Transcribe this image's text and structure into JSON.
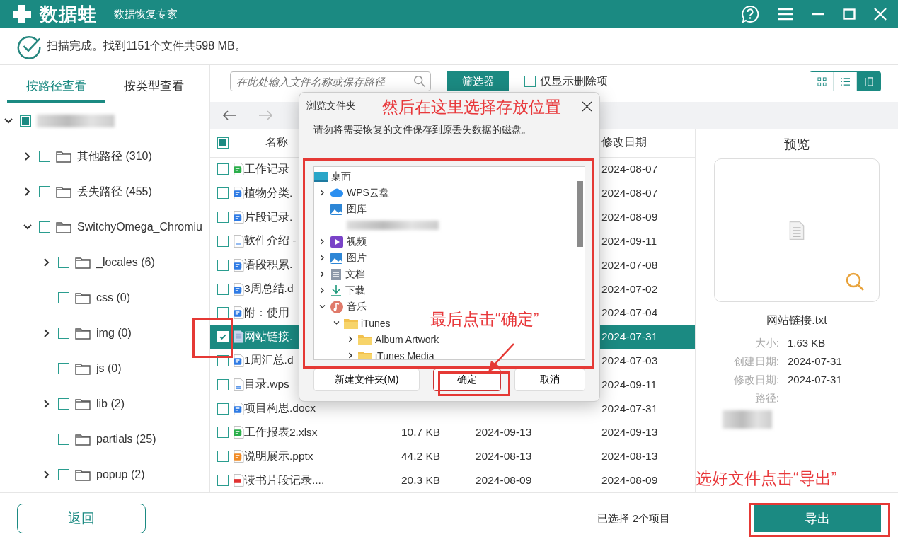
{
  "app": {
    "logo": "数据蛙",
    "subtitle": "数据恢复专家"
  },
  "scan_status": "扫描完成。找到1151个文件共598 MB。",
  "view_tabs": [
    {
      "label": "按路径查看",
      "selected": true
    },
    {
      "label": "按类型查看",
      "selected": false
    }
  ],
  "tree": [
    {
      "redacted": true,
      "checked": false,
      "partial": true,
      "expanded": true,
      "children": [
        {
          "label": "其他路径 (310)",
          "checked": false,
          "expandable": true,
          "expanded": false
        },
        {
          "label": "丢失路径 (455)",
          "checked": false,
          "expandable": true,
          "expanded": false
        },
        {
          "label": "SwitchyOmega_Chromiu",
          "checked": false,
          "expanded": true,
          "children": [
            {
              "label": "_locales (6)",
              "checked": false,
              "expandable": true,
              "expanded": false
            },
            {
              "label": "css (0)",
              "checked": false,
              "expandable": false,
              "expanded": false
            },
            {
              "label": "img (0)",
              "checked": false,
              "expandable": true,
              "expanded": false
            },
            {
              "label": "js (0)",
              "checked": false,
              "expandable": false,
              "expanded": false
            },
            {
              "label": "lib (2)",
              "checked": false,
              "expandable": true,
              "expanded": false
            },
            {
              "label": "partials (25)",
              "checked": false,
              "expandable": false,
              "expanded": false
            },
            {
              "label": "popup (2)",
              "checked": false,
              "expandable": true,
              "expanded": false
            }
          ]
        }
      ]
    }
  ],
  "search": {
    "placeholder": "在此处输入文件名称或保存路径"
  },
  "filter_button": "筛选器",
  "deleted_only": {
    "label": "仅显示删除项",
    "checked": false
  },
  "view_modes": [
    {
      "kind": "grid",
      "selected": false
    },
    {
      "kind": "list",
      "selected": false
    },
    {
      "kind": "preview",
      "selected": true
    }
  ],
  "table": {
    "header_checkbox": {
      "checked": false,
      "partial": true
    },
    "columns": [
      "名称",
      "修改日期"
    ],
    "rows": [
      {
        "kind": "sheet",
        "name": "工作记录",
        "modified": "2024-08-07",
        "checked": false,
        "selected": false
      },
      {
        "kind": "word",
        "name": "植物分类.",
        "modified": "2024-08-07",
        "checked": false,
        "selected": false
      },
      {
        "kind": "word",
        "name": "片段记录.",
        "modified": "2024-08-09",
        "checked": false,
        "selected": false
      },
      {
        "kind": "text",
        "name": "软件介绍 -",
        "modified": "2024-09-11",
        "checked": false,
        "selected": false
      },
      {
        "kind": "word",
        "name": "语段积累.",
        "modified": "2024-07-08",
        "checked": false,
        "selected": false
      },
      {
        "kind": "word",
        "name": "3周总结.d",
        "modified": "2024-07-02",
        "checked": false,
        "selected": false
      },
      {
        "kind": "word",
        "name": "附：使用",
        "modified": "2024-07-04",
        "checked": false,
        "selected": false
      },
      {
        "kind": "note",
        "name": "网站链接.",
        "modified": "2024-07-31",
        "checked": true,
        "selected": true
      },
      {
        "kind": "word",
        "name": "1周汇总.d",
        "modified": "2024-07-03",
        "checked": false,
        "selected": false
      },
      {
        "kind": "text",
        "name": "目录.wps",
        "modified": "2024-09-11",
        "checked": false,
        "selected": false
      },
      {
        "kind": "word",
        "name": "项目构思.docx",
        "modified": "2024-07-31",
        "checked": false,
        "selected": false
      },
      {
        "kind": "sheet",
        "name": "工作报表2.xlsx",
        "size": "10.7 KB",
        "created": "2024-09-13",
        "modified": "2024-09-13",
        "checked": false,
        "selected": false
      },
      {
        "kind": "slides",
        "name": "说明展示.pptx",
        "size": "44.2 KB",
        "created": "2024-08-13",
        "modified": "2024-08-13",
        "checked": false,
        "selected": false
      },
      {
        "kind": "pdf",
        "name": "读书片段记录....",
        "size": "20.3 KB",
        "created": "2024-08-09",
        "modified": "2024-08-09",
        "checked": false,
        "selected": false
      }
    ]
  },
  "preview": {
    "title": "预览",
    "file_name": "网站链接.txt",
    "details": [
      {
        "label": "大小:",
        "value": "1.63 KB"
      },
      {
        "label": "创建日期:",
        "value": "2024-07-31"
      },
      {
        "label": "修改日期:",
        "value": "2024-07-31"
      },
      {
        "label": "路径:",
        "redacted": true
      }
    ]
  },
  "bottom": {
    "back_button": "返回",
    "selection_status": "已选择 2个项目",
    "export_button": "导出"
  },
  "dialog": {
    "title": "浏览文件夹",
    "message": "请勿将需要恢复的文件保存到原丢失数据的磁盘。",
    "folders": [
      {
        "label": "桌面",
        "kind": "desktop",
        "children": [
          {
            "label": "WPS云盘",
            "kind": "cloud",
            "expandable": true,
            "expanded": false
          },
          {
            "label": "图库",
            "kind": "gallery",
            "expandable": false,
            "expanded": false
          },
          {
            "redacted": true,
            "kind": "blank",
            "expandable": false,
            "expanded": false
          },
          {
            "label": "视频",
            "kind": "video",
            "expandable": true,
            "expanded": false
          },
          {
            "label": "图片",
            "kind": "pictures",
            "expandable": true,
            "expanded": false
          },
          {
            "label": "文档",
            "kind": "documents",
            "expandable": true,
            "expanded": false
          },
          {
            "label": "下载",
            "kind": "download",
            "expandable": true,
            "expanded": false
          },
          {
            "label": "音乐",
            "kind": "music",
            "expanded": true,
            "children": [
              {
                "label": "iTunes",
                "kind": "folder",
                "expanded": true,
                "children": [
                  {
                    "label": "Album Artwork",
                    "kind": "folder",
                    "expandable": true,
                    "expanded": false
                  },
                  {
                    "label": "iTunes Media",
                    "kind": "folder",
                    "expandable": true,
                    "expanded": false
                  }
                ]
              }
            ]
          }
        ]
      }
    ],
    "buttons": [
      {
        "label": "新建文件夹(M)",
        "kind": "secondary"
      },
      {
        "label": "确定",
        "kind": "primary"
      },
      {
        "label": "取消",
        "kind": "secondary"
      }
    ]
  },
  "annotations": [
    {
      "text": "然后在这里选择存放位置"
    },
    {
      "text": "最后点击“确定”"
    },
    {
      "text": "选好文件点击“导出”"
    }
  ]
}
